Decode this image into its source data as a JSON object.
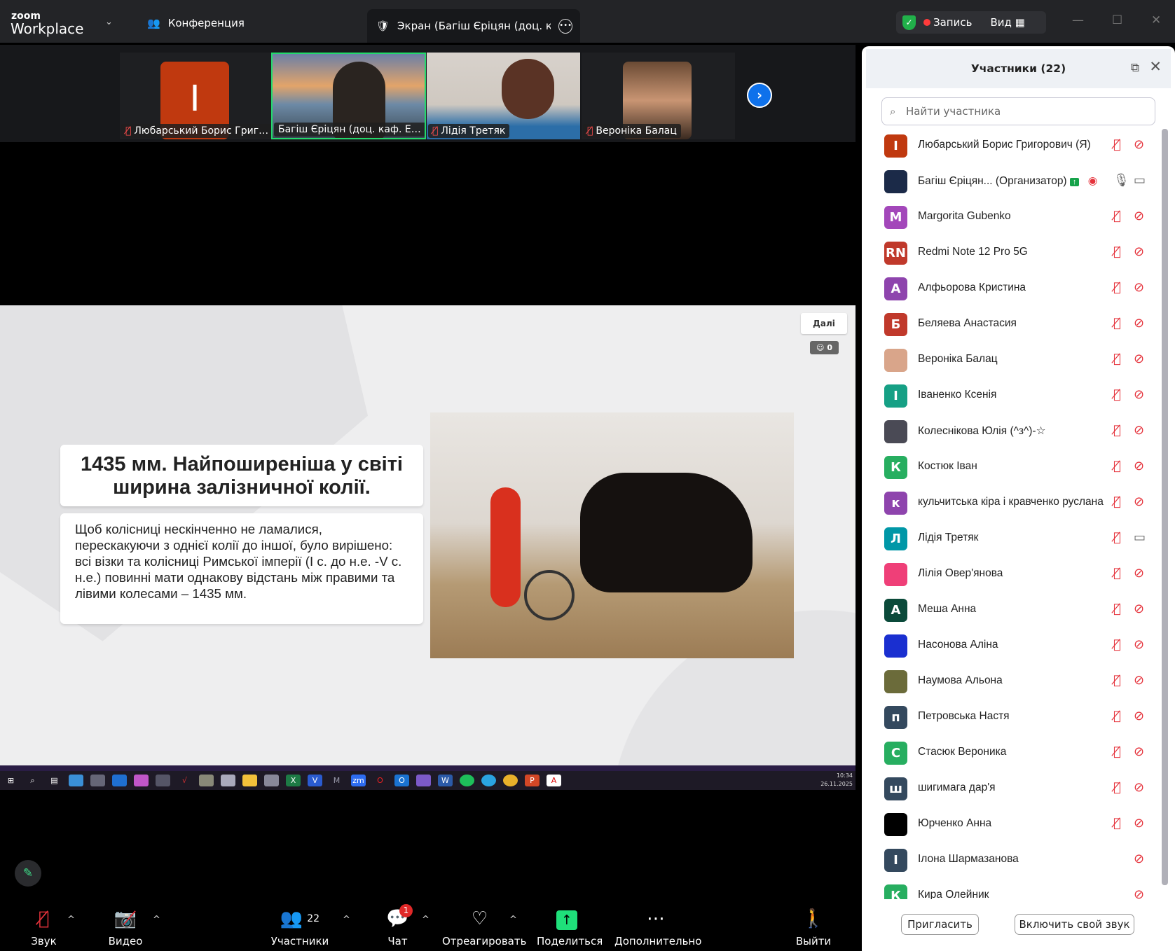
{
  "app": {
    "logo_small": "zoom",
    "logo_big": "Workplace",
    "meeting_label": "Конференция",
    "share_tab": "Экран (Багіш Єріцян (доц. каф. ЕТТ)",
    "record_label": "Запись",
    "view_label": "Вид"
  },
  "thumbnails": [
    {
      "name": "Любарський Борис Григорович",
      "initial": "І",
      "muted": true
    },
    {
      "name": "Багіш Єріцян (доц. каф. ЕТТ)",
      "muted": false,
      "active": true
    },
    {
      "name": "Лідія Третяк",
      "muted": true
    },
    {
      "name": "Вероніка Балац",
      "muted": true
    }
  ],
  "slide": {
    "title_bold": "1435 мм.",
    "title_rest": " Найпоширеніша у світі ширина залізничної колії.",
    "body": "Щоб колісниці нескінченно не ламалися, перескакуючи з однієї колії до іншої, було вирішено: всі візки та колісниці Римської імперії (І с. до н.е. -V с. н.е.) повинні мати однакову відстань між правими та лівими колесами – 1435 мм.",
    "next_label": "Далі",
    "reaction_count": "0"
  },
  "taskbar": {
    "time": "10:34",
    "date": "26.11.2025"
  },
  "toolbar": {
    "audio": "Звук",
    "video": "Видео",
    "participants": "Участники",
    "participants_count": "22",
    "chat": "Чат",
    "chat_badge": "1",
    "react": "Отреагировать",
    "share": "Поделиться",
    "more": "Дополнительно",
    "leave": "Выйти"
  },
  "panel": {
    "title": "Участники (22)",
    "search_placeholder": "Найти участника",
    "invite": "Пригласить",
    "unmute": "Включить свой звук",
    "participants": [
      {
        "name": "Любарський Борис Григорович (Я)",
        "initial": "І",
        "color": "#c0390f",
        "mic": "off",
        "cam": "off"
      },
      {
        "name": "Багіш Єріцян...  (Организатор)",
        "initial": "",
        "color": "#1b2a48",
        "mic": "on",
        "cam": "on",
        "host": true
      },
      {
        "name": "Margorita Gubenko",
        "initial": "M",
        "color": "#a347ba",
        "mic": "off",
        "cam": "off"
      },
      {
        "name": "Redmi Note 12 Pro 5G",
        "initial": "RN",
        "color": "#c0392b",
        "mic": "off",
        "cam": "off"
      },
      {
        "name": "Алфьорова Кристина",
        "initial": "А",
        "color": "#8e44ad",
        "mic": "off",
        "cam": "off"
      },
      {
        "name": "Беляева Анастасия",
        "initial": "Б",
        "color": "#c0392b",
        "mic": "off",
        "cam": "off"
      },
      {
        "name": "Вероніка Балац",
        "initial": "",
        "color": "#d9a58a",
        "mic": "off",
        "cam": "off"
      },
      {
        "name": "Іваненко Ксенія",
        "initial": "І",
        "color": "#16a085",
        "mic": "off",
        "cam": "off"
      },
      {
        "name": "Колеснікова Юлія (^з^)-☆",
        "initial": "",
        "color": "#4a4a55",
        "mic": "off",
        "cam": "off"
      },
      {
        "name": "Костюк Іван",
        "initial": "К",
        "color": "#27ae60",
        "mic": "off",
        "cam": "off"
      },
      {
        "name": "кульчитська кіра і кравченко руслана",
        "initial": "к",
        "color": "#8e44ad",
        "mic": "off",
        "cam": "off"
      },
      {
        "name": "Лідія Третяк",
        "initial": "Л",
        "color": "#0097a7",
        "mic": "off",
        "cam": "on"
      },
      {
        "name": "Лілія Овер'янова",
        "initial": "",
        "color": "#ef3f78",
        "mic": "off",
        "cam": "off"
      },
      {
        "name": "Меша Анна",
        "initial": "A",
        "color": "#0b4a3a",
        "mic": "off",
        "cam": "off"
      },
      {
        "name": "Насонова Аліна",
        "initial": "",
        "color": "#1a2fd0",
        "mic": "off",
        "cam": "off"
      },
      {
        "name": "Наумова Альона",
        "initial": "",
        "color": "#6b6b3a",
        "mic": "off",
        "cam": "off"
      },
      {
        "name": "Петровська Настя",
        "initial": "п",
        "color": "#34495e",
        "mic": "off",
        "cam": "off"
      },
      {
        "name": "Стасюк Вероника",
        "initial": "С",
        "color": "#27ae60",
        "mic": "off",
        "cam": "off"
      },
      {
        "name": "шигимага дар'я",
        "initial": "ш",
        "color": "#34495e",
        "mic": "off",
        "cam": "off"
      },
      {
        "name": "Юрченко Анна",
        "initial": "",
        "color": "#000000",
        "mic": "off",
        "cam": "off"
      },
      {
        "name": "Ілона Шармазанова",
        "initial": "І",
        "color": "#34495e",
        "mic": "none",
        "cam": "off"
      },
      {
        "name": "Кира Олейник",
        "initial": "К",
        "color": "#27ae60",
        "mic": "none",
        "cam": "off"
      }
    ]
  }
}
